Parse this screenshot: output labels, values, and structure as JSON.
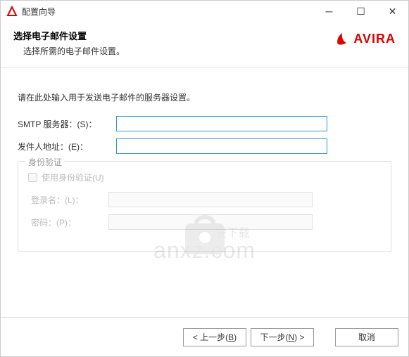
{
  "titlebar": {
    "title": "配置向导"
  },
  "header": {
    "title": "选择电子邮件设置",
    "subtitle": "选择所需的电子邮件设置。",
    "brand": "AVIRA"
  },
  "content": {
    "instruction": "请在此处输入用于发送电子邮件的服务器设置。",
    "smtp_label": "SMTP 服务器：(S)：",
    "smtp_value": "",
    "sender_label": "发件人地址：(E)：",
    "sender_value": "",
    "auth": {
      "legend": "身份验证",
      "use_auth_label": "使用身份验证(U)",
      "use_auth_checked": false,
      "login_label": "登录名：(L)：",
      "login_value": "",
      "password_label": "密码：(P)：",
      "password_value": ""
    }
  },
  "watermark": {
    "text": "anxz.com",
    "sub": "安下载"
  },
  "footer": {
    "back": "< 上一步(B)",
    "next": "下一步(N) >",
    "cancel": "取消"
  }
}
